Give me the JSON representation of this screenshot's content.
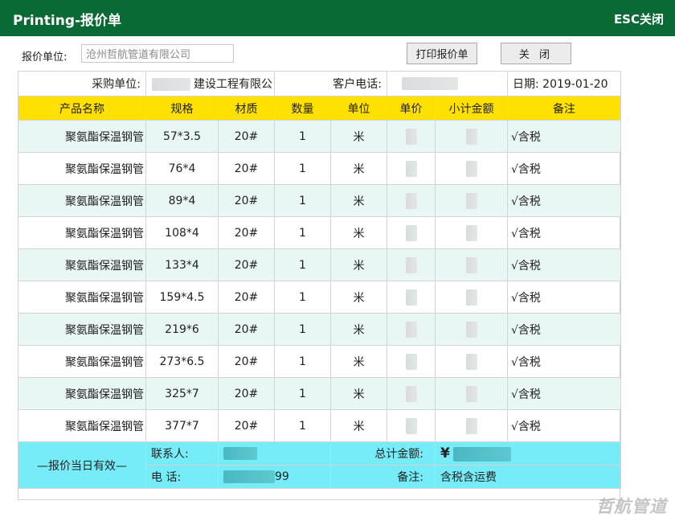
{
  "header": {
    "title": "Printing-报价单",
    "esc_label": "ESC关闭"
  },
  "toolbar": {
    "unit_label": "报价单位:",
    "unit_value": "沧州哲航管道有限公司",
    "print_button": "打印报价单",
    "close_button": "关 闭"
  },
  "info": {
    "buyer_label": "采购单位:",
    "buyer_value": "建设工程有限公",
    "phone_label": "客户电话:",
    "date_text": "日期:  2019-01-20"
  },
  "columns": [
    "产品名称",
    "规格",
    "材质",
    "数量",
    "单位",
    "单价",
    "小计金额",
    "备注"
  ],
  "items": [
    {
      "name": "聚氨酯保温钢管",
      "spec": "57*3.5",
      "material": "20#",
      "qty": "1",
      "unit": "米",
      "remark": "√含税"
    },
    {
      "name": "聚氨酯保温钢管",
      "spec": "76*4",
      "material": "20#",
      "qty": "1",
      "unit": "米",
      "remark": "√含税"
    },
    {
      "name": "聚氨酯保温钢管",
      "spec": "89*4",
      "material": "20#",
      "qty": "1",
      "unit": "米",
      "remark": "√含税"
    },
    {
      "name": "聚氨酯保温钢管",
      "spec": "108*4",
      "material": "20#",
      "qty": "1",
      "unit": "米",
      "remark": "√含税"
    },
    {
      "name": "聚氨酯保温钢管",
      "spec": "133*4",
      "material": "20#",
      "qty": "1",
      "unit": "米",
      "remark": "√含税"
    },
    {
      "name": "聚氨酯保温钢管",
      "spec": "159*4.5",
      "material": "20#",
      "qty": "1",
      "unit": "米",
      "remark": "√含税"
    },
    {
      "name": "聚氨酯保温钢管",
      "spec": "219*6",
      "material": "20#",
      "qty": "1",
      "unit": "米",
      "remark": "√含税"
    },
    {
      "name": "聚氨酯保温钢管",
      "spec": "273*6.5",
      "material": "20#",
      "qty": "1",
      "unit": "米",
      "remark": "√含税"
    },
    {
      "name": "聚氨酯保温钢管",
      "spec": "325*7",
      "material": "20#",
      "qty": "1",
      "unit": "米",
      "remark": "√含税"
    },
    {
      "name": "聚氨酯保温钢管",
      "spec": "377*7",
      "material": "20#",
      "qty": "1",
      "unit": "米",
      "remark": "√含税"
    }
  ],
  "footer": {
    "validity": "—报价当日有效—",
    "contact_label": "联系人:",
    "phone_label": "电  话:",
    "phone_suffix": "99",
    "total_label": "总计金额:",
    "currency": "¥",
    "note_label": "备注:",
    "note_value": "含税含运费"
  },
  "watermark": "哲航管道",
  "colors": {
    "titlebar": "#0a6a35",
    "header_row": "#ffe100",
    "row_alt": "#e9f6f6",
    "footer_row": "#76ecf8"
  }
}
